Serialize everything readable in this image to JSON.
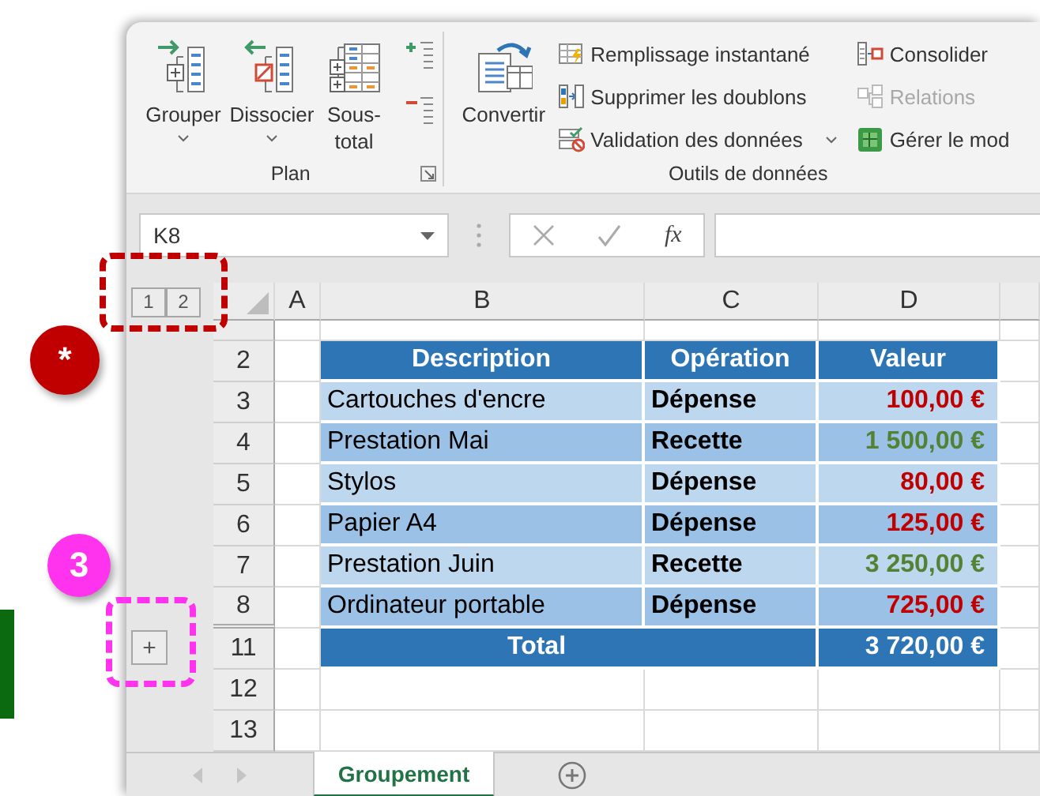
{
  "ribbon": {
    "groups": [
      {
        "kind": "plan",
        "title": "Plan",
        "large_buttons": [
          {
            "label": "Grouper",
            "dropdown": true
          },
          {
            "label": "Dissocier",
            "dropdown": true
          },
          {
            "label": "Sous-total",
            "dropdown": false
          }
        ],
        "launcher": true
      },
      {
        "kind": "data_tools",
        "title": "Outils de données",
        "large_buttons": [
          {
            "label": "Convertir",
            "dropdown": false
          }
        ],
        "columns": [
          [
            {
              "label": "Remplissage instantané",
              "disabled": false,
              "dropdown": false
            },
            {
              "label": "Supprimer les doublons",
              "disabled": false,
              "dropdown": false
            },
            {
              "label": "Validation des données",
              "disabled": false,
              "dropdown": true
            }
          ],
          [
            {
              "label": "Consolider",
              "disabled": false,
              "dropdown": false
            },
            {
              "label": "Relations",
              "disabled": true,
              "dropdown": false
            },
            {
              "label": "Gérer le mod",
              "disabled": false,
              "dropdown": false
            }
          ]
        ]
      }
    ]
  },
  "formula_bar": {
    "name_box": "K8",
    "function_label": "fx"
  },
  "sheet": {
    "outline_levels": [
      "1",
      "2"
    ],
    "columns": [
      "A",
      "B",
      "C",
      "D"
    ],
    "rows": [
      {
        "kind": "partial"
      },
      {
        "number": "2",
        "kind": "header",
        "cells": [
          "Description",
          "Opération",
          "Valeur"
        ]
      },
      {
        "number": "3",
        "kind": "entry",
        "description": "Cartouches d'encre",
        "operation": "Dépense",
        "value": "100,00 €",
        "color": "#c00000"
      },
      {
        "number": "4",
        "kind": "entry",
        "description": "Prestation Mai",
        "operation": "Recette",
        "value": "1 500,00 €",
        "color": "#548235"
      },
      {
        "number": "5",
        "kind": "entry",
        "description": "Stylos",
        "operation": "Dépense",
        "value": "80,00 €",
        "color": "#c00000"
      },
      {
        "number": "6",
        "kind": "entry",
        "description": "Papier A4",
        "operation": "Dépense",
        "value": "125,00 €",
        "color": "#c00000"
      },
      {
        "number": "7",
        "kind": "entry",
        "description": "Prestation Juin",
        "operation": "Recette",
        "value": "3 250,00 €",
        "color": "#548235"
      },
      {
        "number": "8",
        "kind": "entry",
        "description": "Ordinateur portable",
        "operation": "Dépense",
        "value": "725,00 €",
        "color": "#c00000"
      },
      {
        "number": "11",
        "kind": "total",
        "label": "Total",
        "value": "3 720,00 €",
        "outline_button": "+"
      },
      {
        "number": "12",
        "kind": "blank"
      },
      {
        "number": "13",
        "kind": "blank"
      }
    ]
  },
  "sheet_tabs": [
    {
      "label": "Groupement",
      "selected": true
    }
  ],
  "annotations": [
    {
      "label": "*",
      "color": "#c00000"
    },
    {
      "label": "3",
      "color": "#ff33ee"
    }
  ]
}
